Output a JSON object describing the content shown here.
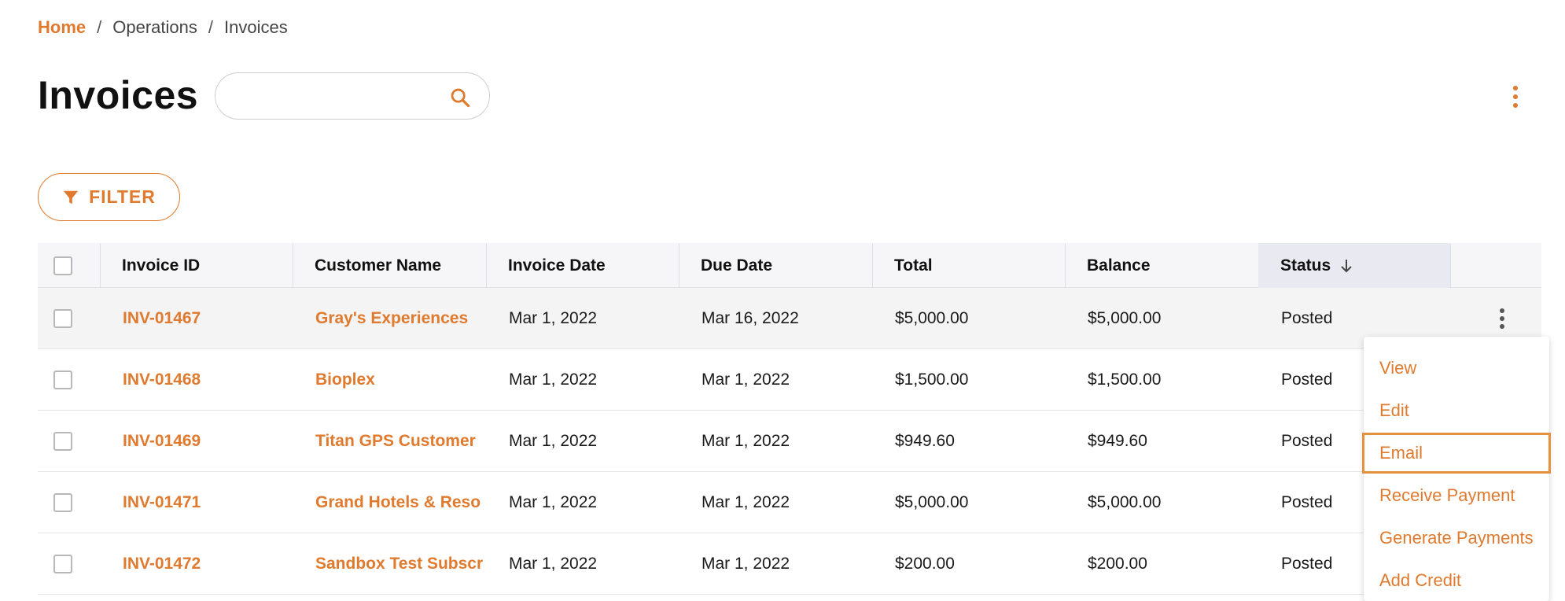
{
  "breadcrumb": {
    "home": "Home",
    "separator": "/",
    "items": [
      "Operations",
      "Invoices"
    ]
  },
  "page": {
    "title": "Invoices"
  },
  "search": {
    "placeholder": "",
    "value": "",
    "icon": "search-icon"
  },
  "filter": {
    "label": "FILTER",
    "icon": "filter-icon"
  },
  "colors": {
    "accent": "#e07a2e",
    "header_bg": "#f6f6f8"
  },
  "table": {
    "columns": [
      "Invoice ID",
      "Customer Name",
      "Invoice Date",
      "Due Date",
      "Total",
      "Balance",
      "Status"
    ],
    "sorted_column": "Status",
    "sort_direction": "descending",
    "rows": [
      {
        "id": "INV-01467",
        "customer": "Gray's Experiences",
        "invoice_date": "Mar 1, 2022",
        "due_date": "Mar 16, 2022",
        "total": "$5,000.00",
        "balance": "$5,000.00",
        "status": "Posted"
      },
      {
        "id": "INV-01468",
        "customer": "Bioplex",
        "invoice_date": "Mar 1, 2022",
        "due_date": "Mar 1, 2022",
        "total": "$1,500.00",
        "balance": "$1,500.00",
        "status": "Posted"
      },
      {
        "id": "INV-01469",
        "customer": "Titan GPS Customer",
        "invoice_date": "Mar 1, 2022",
        "due_date": "Mar 1, 2022",
        "total": "$949.60",
        "balance": "$949.60",
        "status": "Posted"
      },
      {
        "id": "INV-01471",
        "customer": "Grand Hotels & Reso",
        "invoice_date": "Mar 1, 2022",
        "due_date": "Mar 1, 2022",
        "total": "$5,000.00",
        "balance": "$5,000.00",
        "status": "Posted"
      },
      {
        "id": "INV-01472",
        "customer": "Sandbox Test Subscr",
        "invoice_date": "Mar 1, 2022",
        "due_date": "Mar 1, 2022",
        "total": "$200.00",
        "balance": "$200.00",
        "status": "Posted"
      }
    ]
  },
  "row_menu": {
    "items": [
      "View",
      "Edit",
      "Email",
      "Receive Payment",
      "Generate Payments",
      "Add Credit"
    ],
    "focused": "Email"
  }
}
